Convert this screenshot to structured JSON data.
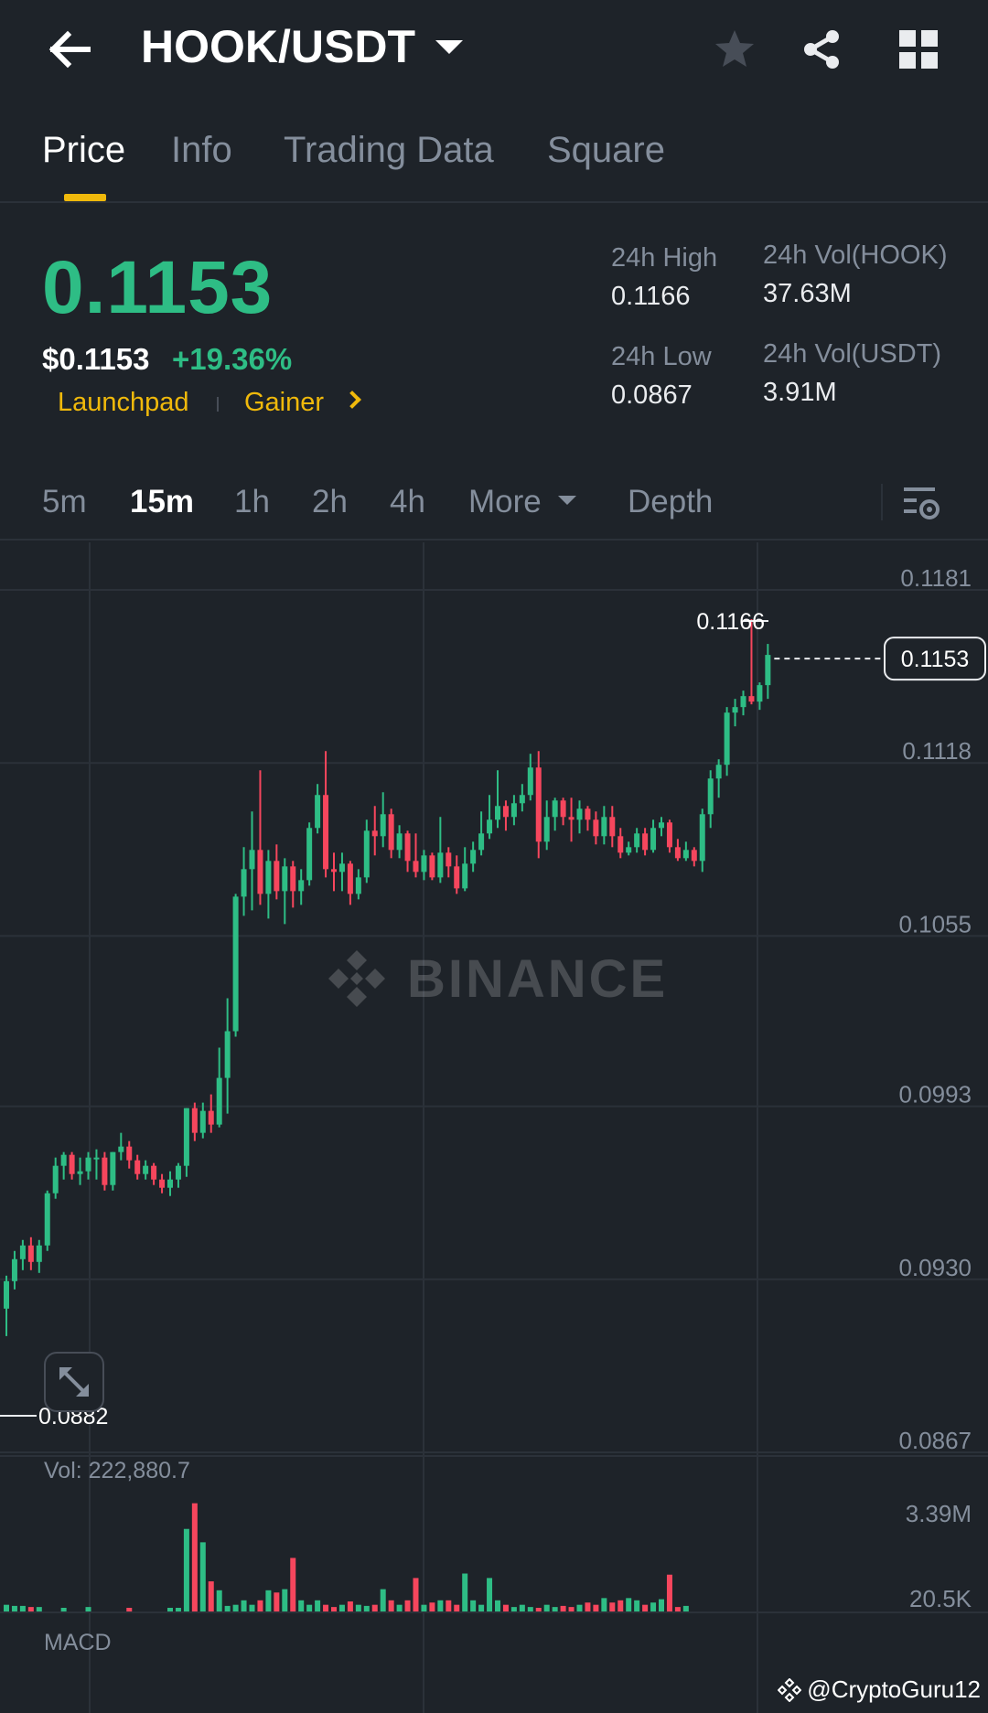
{
  "header": {
    "pair": "HOOK/USDT",
    "back_icon": "arrow-left-icon",
    "favorite_icon": "star-icon",
    "share_icon": "share-icon",
    "grid_icon": "grid-icon"
  },
  "tabs": [
    {
      "label": "Price",
      "active": true
    },
    {
      "label": "Info",
      "active": false
    },
    {
      "label": "Trading Data",
      "active": false
    },
    {
      "label": "Square",
      "active": false
    }
  ],
  "ticker": {
    "last_price": "0.1153",
    "usd_price": "$0.1153",
    "change_pct": "+19.36%",
    "tags": [
      "Launchpad",
      "Gainer"
    ],
    "stats": {
      "high_label": "24h High",
      "high_value": "0.1166",
      "low_label": "24h Low",
      "low_value": "0.0867",
      "vol_base_label": "24h Vol(HOOK)",
      "vol_base_value": "37.63M",
      "vol_quote_label": "24h Vol(USDT)",
      "vol_quote_value": "3.91M"
    }
  },
  "intervals": {
    "items": [
      "5m",
      "15m",
      "1h",
      "2h",
      "4h"
    ],
    "active": "15m",
    "more_label": "More",
    "depth_label": "Depth"
  },
  "chart_data": {
    "type": "candlestick",
    "interval": "15m",
    "y_ticks": [
      "0.1181",
      "0.1118",
      "0.1055",
      "0.0993",
      "0.0930",
      "0.0867"
    ],
    "ylim": [
      0.0867,
      0.1181
    ],
    "last_price_label": "0.1153",
    "high_marker": "0.1166",
    "low_marker": "0.0882",
    "volume": {
      "label": "Vol: 222,880.7",
      "y_ticks": [
        "3.39M",
        "20.5K"
      ]
    },
    "indicator_label": "MACD",
    "watermark": "BINANCE",
    "candles": [
      [
        0.0915,
        0.0925,
        0.0905,
        0.0927
      ],
      [
        0.0925,
        0.0933,
        0.0922,
        0.0936
      ],
      [
        0.0933,
        0.0938,
        0.0929,
        0.094
      ],
      [
        0.0938,
        0.0932,
        0.0929,
        0.0941
      ],
      [
        0.0932,
        0.0938,
        0.0928,
        0.094
      ],
      [
        0.0938,
        0.0957,
        0.0936,
        0.0958
      ],
      [
        0.0957,
        0.0967,
        0.0955,
        0.097
      ],
      [
        0.0967,
        0.0971,
        0.0962,
        0.0972
      ],
      [
        0.0971,
        0.0964,
        0.0962,
        0.0972
      ],
      [
        0.0964,
        0.0965,
        0.096,
        0.097
      ],
      [
        0.0965,
        0.097,
        0.0962,
        0.0972
      ],
      [
        0.097,
        0.097,
        0.0962,
        0.0973
      ],
      [
        0.097,
        0.096,
        0.0958,
        0.0972
      ],
      [
        0.096,
        0.0972,
        0.0958,
        0.0972
      ],
      [
        0.0972,
        0.0974,
        0.0969,
        0.0979
      ],
      [
        0.0974,
        0.0969,
        0.0966,
        0.0976
      ],
      [
        0.0969,
        0.0964,
        0.0962,
        0.0971
      ],
      [
        0.0964,
        0.0967,
        0.0962,
        0.0969
      ],
      [
        0.0967,
        0.0962,
        0.096,
        0.0968
      ],
      [
        0.0962,
        0.0959,
        0.0957,
        0.0964
      ],
      [
        0.0959,
        0.0962,
        0.0956,
        0.0965
      ],
      [
        0.0962,
        0.0967,
        0.0959,
        0.0968
      ],
      [
        0.0967,
        0.0988,
        0.0963,
        0.0988
      ],
      [
        0.0988,
        0.0979,
        0.0976,
        0.099
      ],
      [
        0.0979,
        0.0987,
        0.0977,
        0.099
      ],
      [
        0.0987,
        0.0982,
        0.0979,
        0.0993
      ],
      [
        0.0982,
        0.0999,
        0.0981,
        0.101
      ],
      [
        0.0999,
        0.1016,
        0.0986,
        0.1028
      ],
      [
        0.1016,
        0.1065,
        0.1014,
        0.1066
      ],
      [
        0.1065,
        0.1075,
        0.1058,
        0.1083
      ],
      [
        0.1075,
        0.1082,
        0.106,
        0.1096
      ],
      [
        0.1082,
        0.1066,
        0.1062,
        0.1111
      ],
      [
        0.1066,
        0.1078,
        0.1057,
        0.1082
      ],
      [
        0.1078,
        0.1067,
        0.1064,
        0.1084
      ],
      [
        0.1067,
        0.1076,
        0.1055,
        0.1079
      ],
      [
        0.1076,
        0.1067,
        0.1061,
        0.1078
      ],
      [
        0.1067,
        0.1071,
        0.1062,
        0.1075
      ],
      [
        0.1071,
        0.109,
        0.1069,
        0.1092
      ],
      [
        0.109,
        0.1102,
        0.1088,
        0.1106
      ],
      [
        0.1102,
        0.1075,
        0.1072,
        0.1118
      ],
      [
        0.1075,
        0.1074,
        0.1067,
        0.1081
      ],
      [
        0.1074,
        0.1077,
        0.1067,
        0.1081
      ],
      [
        0.1077,
        0.1066,
        0.1062,
        0.1078
      ],
      [
        0.1066,
        0.1072,
        0.1064,
        0.1075
      ],
      [
        0.1072,
        0.1089,
        0.107,
        0.1093
      ],
      [
        0.1089,
        0.1087,
        0.108,
        0.1098
      ],
      [
        0.1087,
        0.1095,
        0.1083,
        0.1103
      ],
      [
        0.1095,
        0.1082,
        0.1079,
        0.1097
      ],
      [
        0.1082,
        0.1088,
        0.1079,
        0.1091
      ],
      [
        0.1088,
        0.1078,
        0.1074,
        0.1089
      ],
      [
        0.1078,
        0.1074,
        0.1072,
        0.1088
      ],
      [
        0.1074,
        0.108,
        0.1071,
        0.1082
      ],
      [
        0.108,
        0.1072,
        0.1071,
        0.1081
      ],
      [
        0.1072,
        0.1081,
        0.107,
        0.1094
      ],
      [
        0.1081,
        0.1076,
        0.1072,
        0.1083
      ],
      [
        0.1076,
        0.1068,
        0.1066,
        0.108
      ],
      [
        0.1068,
        0.1077,
        0.1067,
        0.1083
      ],
      [
        0.1077,
        0.1082,
        0.1074,
        0.1085
      ],
      [
        0.1082,
        0.1088,
        0.108,
        0.1096
      ],
      [
        0.1088,
        0.1093,
        0.1086,
        0.1102
      ],
      [
        0.1093,
        0.1098,
        0.109,
        0.1111
      ],
      [
        0.1098,
        0.1094,
        0.1089,
        0.11
      ],
      [
        0.1094,
        0.1099,
        0.1091,
        0.1102
      ],
      [
        0.1099,
        0.1102,
        0.1096,
        0.1106
      ],
      [
        0.1102,
        0.1112,
        0.11,
        0.1117
      ],
      [
        0.1112,
        0.1085,
        0.1079,
        0.1118
      ],
      [
        0.1085,
        0.1094,
        0.1082,
        0.11
      ],
      [
        0.1094,
        0.11,
        0.1089,
        0.1101
      ],
      [
        0.11,
        0.1094,
        0.1091,
        0.1101
      ],
      [
        0.1094,
        0.1093,
        0.1085,
        0.1101
      ],
      [
        0.1093,
        0.1097,
        0.1088,
        0.11
      ],
      [
        0.1097,
        0.1093,
        0.1089,
        0.1098
      ],
      [
        0.1093,
        0.1087,
        0.1084,
        0.1096
      ],
      [
        0.1087,
        0.1094,
        0.1084,
        0.1098
      ],
      [
        0.1094,
        0.1087,
        0.1083,
        0.1098
      ],
      [
        0.1087,
        0.1081,
        0.1079,
        0.109
      ],
      [
        0.1081,
        0.1083,
        0.108,
        0.1085
      ],
      [
        0.1083,
        0.1088,
        0.1081,
        0.109
      ],
      [
        0.1088,
        0.1082,
        0.108,
        0.109
      ],
      [
        0.1082,
        0.109,
        0.1081,
        0.1093
      ],
      [
        0.109,
        0.1092,
        0.1087,
        0.1094
      ],
      [
        0.1092,
        0.1083,
        0.1081,
        0.1093
      ],
      [
        0.1083,
        0.1079,
        0.1078,
        0.1086
      ],
      [
        0.1079,
        0.1082,
        0.1078,
        0.1085
      ],
      [
        0.1082,
        0.1078,
        0.1076,
        0.1083
      ],
      [
        0.1078,
        0.1095,
        0.1074,
        0.1097
      ],
      [
        0.1095,
        0.1108,
        0.109,
        0.1111
      ],
      [
        0.1108,
        0.1113,
        0.1101,
        0.1115
      ],
      [
        0.1113,
        0.1132,
        0.1109,
        0.1134
      ],
      [
        0.1132,
        0.1134,
        0.1127,
        0.1137
      ],
      [
        0.1134,
        0.1138,
        0.1131,
        0.114
      ],
      [
        0.1138,
        0.1136,
        0.1135,
        0.1166
      ],
      [
        0.1136,
        0.1142,
        0.1133,
        0.1143
      ],
      [
        0.1142,
        0.1153,
        0.1137,
        0.1157
      ]
    ],
    "volumes": [
      0.06,
      0.05,
      0.05,
      0.04,
      0.04,
      0.0,
      0.0,
      0.01,
      0.0,
      0.0,
      0.04,
      0.0,
      0.0,
      0.0,
      0.0,
      0.01,
      0.0,
      0.0,
      0.0,
      0.0,
      0.01,
      0.02,
      0.74,
      0.97,
      0.62,
      0.27,
      0.19,
      0.05,
      0.06,
      0.1,
      0.06,
      0.1,
      0.19,
      0.17,
      0.2,
      0.48,
      0.1,
      0.06,
      0.1,
      0.06,
      0.04,
      0.06,
      0.09,
      0.06,
      0.05,
      0.06,
      0.2,
      0.1,
      0.06,
      0.1,
      0.3,
      0.06,
      0.08,
      0.1,
      0.1,
      0.06,
      0.34,
      0.1,
      0.06,
      0.3,
      0.1,
      0.06,
      0.04,
      0.06,
      0.04,
      0.03,
      0.06,
      0.04,
      0.05,
      0.04,
      0.06,
      0.08,
      0.06,
      0.12,
      0.08,
      0.1,
      0.12,
      0.1,
      0.06,
      0.08,
      0.11,
      0.33,
      0.04,
      0.05
    ]
  },
  "footer": {
    "user_handle": "@CryptoGuru12"
  }
}
